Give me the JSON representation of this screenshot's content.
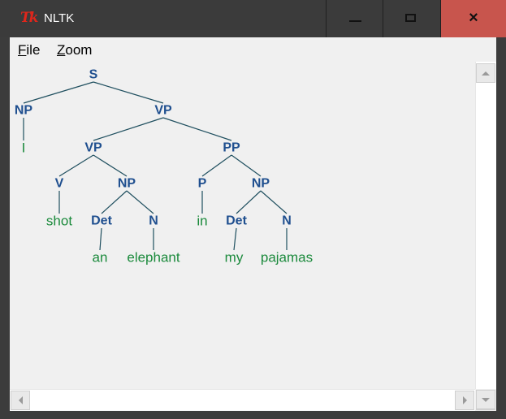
{
  "window": {
    "title": "NLTK",
    "icon": "tk-feather-icon",
    "controls": {
      "minimize": "minimize-icon",
      "maximize": "maximize-icon",
      "close": "×"
    }
  },
  "menu": [
    {
      "underline": "F",
      "rest": "ile"
    },
    {
      "underline": "Z",
      "rest": "oom"
    }
  ],
  "tree_colors": {
    "node": "#1f4f8f",
    "leaf": "#1b8a3c",
    "edge": "#1f4f5f"
  },
  "tree": {
    "labels": {
      "s": "S",
      "np1": "NP",
      "i": "I",
      "vp1": "VP",
      "vp2": "VP",
      "v": "V",
      "shot": "shot",
      "np2": "NP",
      "det1": "Det",
      "an": "an",
      "n1": "N",
      "elephant": "elephant",
      "pp": "PP",
      "p": "P",
      "in": "in",
      "np3": "NP",
      "det2": "Det",
      "my": "my",
      "n2": "N",
      "pajamas": "pajamas"
    },
    "edges": [
      [
        "s",
        "np1"
      ],
      [
        "s",
        "vp1"
      ],
      [
        "np1",
        "i"
      ],
      [
        "vp1",
        "vp2"
      ],
      [
        "vp1",
        "pp"
      ],
      [
        "vp2",
        "v"
      ],
      [
        "vp2",
        "np2"
      ],
      [
        "v",
        "shot"
      ],
      [
        "np2",
        "det1"
      ],
      [
        "np2",
        "n1"
      ],
      [
        "det1",
        "an"
      ],
      [
        "n1",
        "elephant"
      ],
      [
        "pp",
        "p"
      ],
      [
        "pp",
        "np3"
      ],
      [
        "p",
        "in"
      ],
      [
        "np3",
        "det2"
      ],
      [
        "np3",
        "n2"
      ],
      [
        "det2",
        "my"
      ],
      [
        "n2",
        "pajamas"
      ]
    ],
    "leaves": [
      "i",
      "shot",
      "an",
      "elephant",
      "in",
      "my",
      "pajamas"
    ]
  }
}
